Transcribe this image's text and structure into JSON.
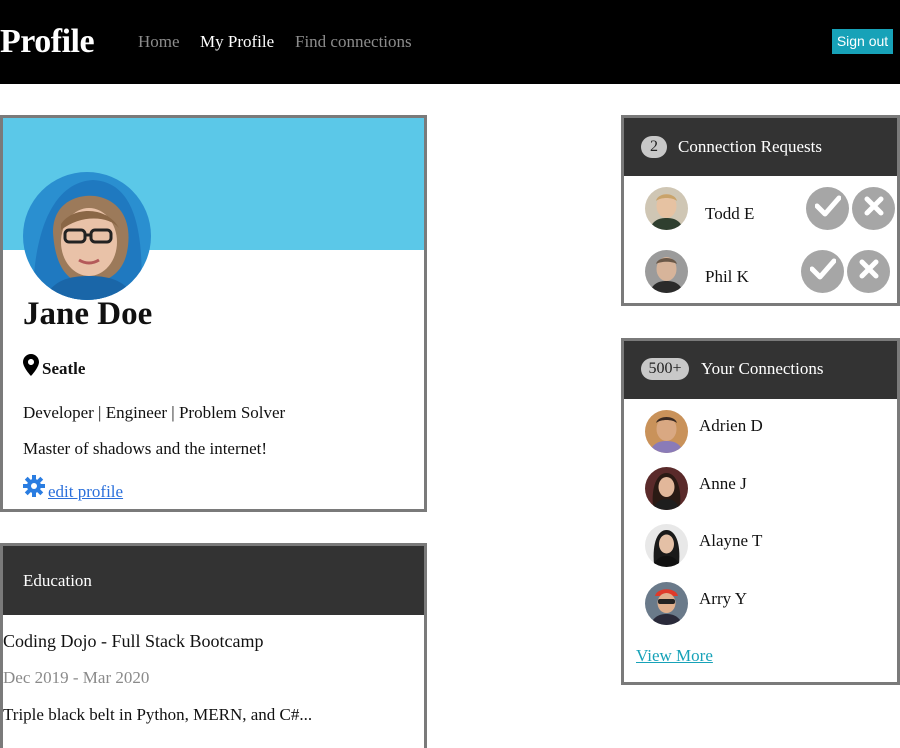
{
  "nav": {
    "brand": "Profile",
    "links": [
      {
        "label": "Home",
        "active": false
      },
      {
        "label": "My Profile",
        "active": true
      },
      {
        "label": "Find connections",
        "active": false
      }
    ],
    "signout_label": "Sign out"
  },
  "profile": {
    "name": "Jane Doe",
    "location": "Seatle",
    "tagline": "Developer | Engineer | Problem Solver",
    "bio": "Master of shadows and the internet!",
    "edit_label": " edit profile"
  },
  "education": {
    "title": "Education",
    "school": "Coding Dojo - Full Stack Bootcamp",
    "dates": "Dec 2019 - Mar 2020",
    "description": "Triple black belt in Python, MERN, and C#..."
  },
  "requests": {
    "count": "2",
    "title": "Connection Requests",
    "items": [
      {
        "name": "Todd E"
      },
      {
        "name": "Phil K"
      }
    ]
  },
  "connections": {
    "count": "500+",
    "title": "Your Connections",
    "items": [
      {
        "name": "Adrien D"
      },
      {
        "name": "Anne J"
      },
      {
        "name": "Alayne T"
      },
      {
        "name": "Arry Y"
      }
    ],
    "view_more_label": "View More"
  },
  "colors": {
    "navbar": "#000000",
    "cover": "#5bc8e8",
    "card_header": "#333333",
    "accent": "#17a2b8",
    "link": "#2a6fdb",
    "action_button": "#a6a6a6"
  },
  "icons": {
    "location": "map-pin-icon",
    "edit": "gear-icon",
    "accept": "check-icon",
    "decline": "x-icon"
  }
}
